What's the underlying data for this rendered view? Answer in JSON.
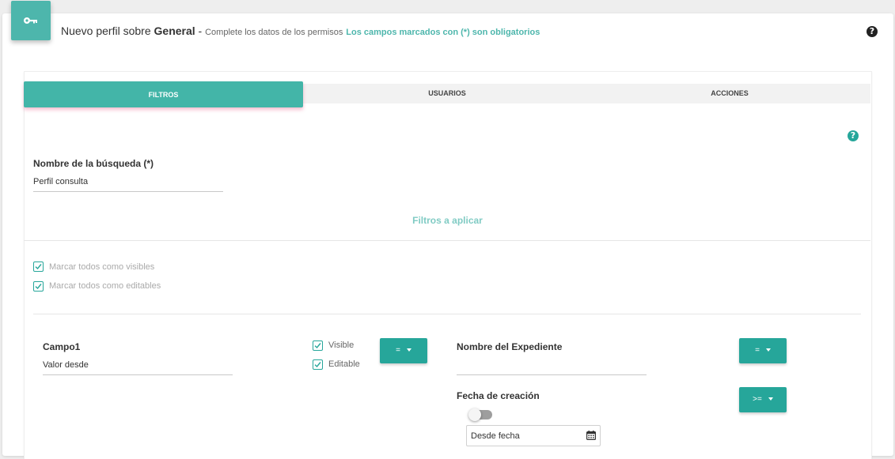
{
  "header": {
    "icon": "key-icon",
    "title_prefix": "Nuevo perfil sobre ",
    "title_bold": "General",
    "title_sep": " - ",
    "subtitle": "Complete los datos de los permisos",
    "required_note": "Los campos marcados con (*) son obligatorios",
    "help_icon": "question-circle-icon",
    "accent_color": "#4db6ac"
  },
  "tabs": [
    {
      "label": "FILTROS",
      "active": true
    },
    {
      "label": "USUARIOS",
      "active": false
    },
    {
      "label": "ACCIONES",
      "active": false
    }
  ],
  "form": {
    "help_icon": "question-circle-icon",
    "search_name_label": "Nombre de la búsqueda (*)",
    "search_name_value": "Perfil consulta",
    "filters_title": "Filtros a aplicar",
    "mark_all_visible": "Marcar todos como visibles",
    "mark_all_editable": "Marcar todos como editables"
  },
  "fields": {
    "campo1": {
      "label": "Campo1",
      "placeholder": "Valor desde",
      "visible_label": "Visible",
      "visible_checked": true,
      "editable_label": "Editable",
      "editable_checked": true,
      "operator": "="
    },
    "expediente": {
      "label": "Nombre del Expediente",
      "value": "",
      "operator": "="
    },
    "fecha": {
      "label": "Fecha de creación",
      "toggle_on": false,
      "date_placeholder": "Desde fecha",
      "operator": ">="
    }
  },
  "colors": {
    "primary": "#26a69a",
    "tab_active": "#43b5a8",
    "section_title": "#80cbc4"
  }
}
